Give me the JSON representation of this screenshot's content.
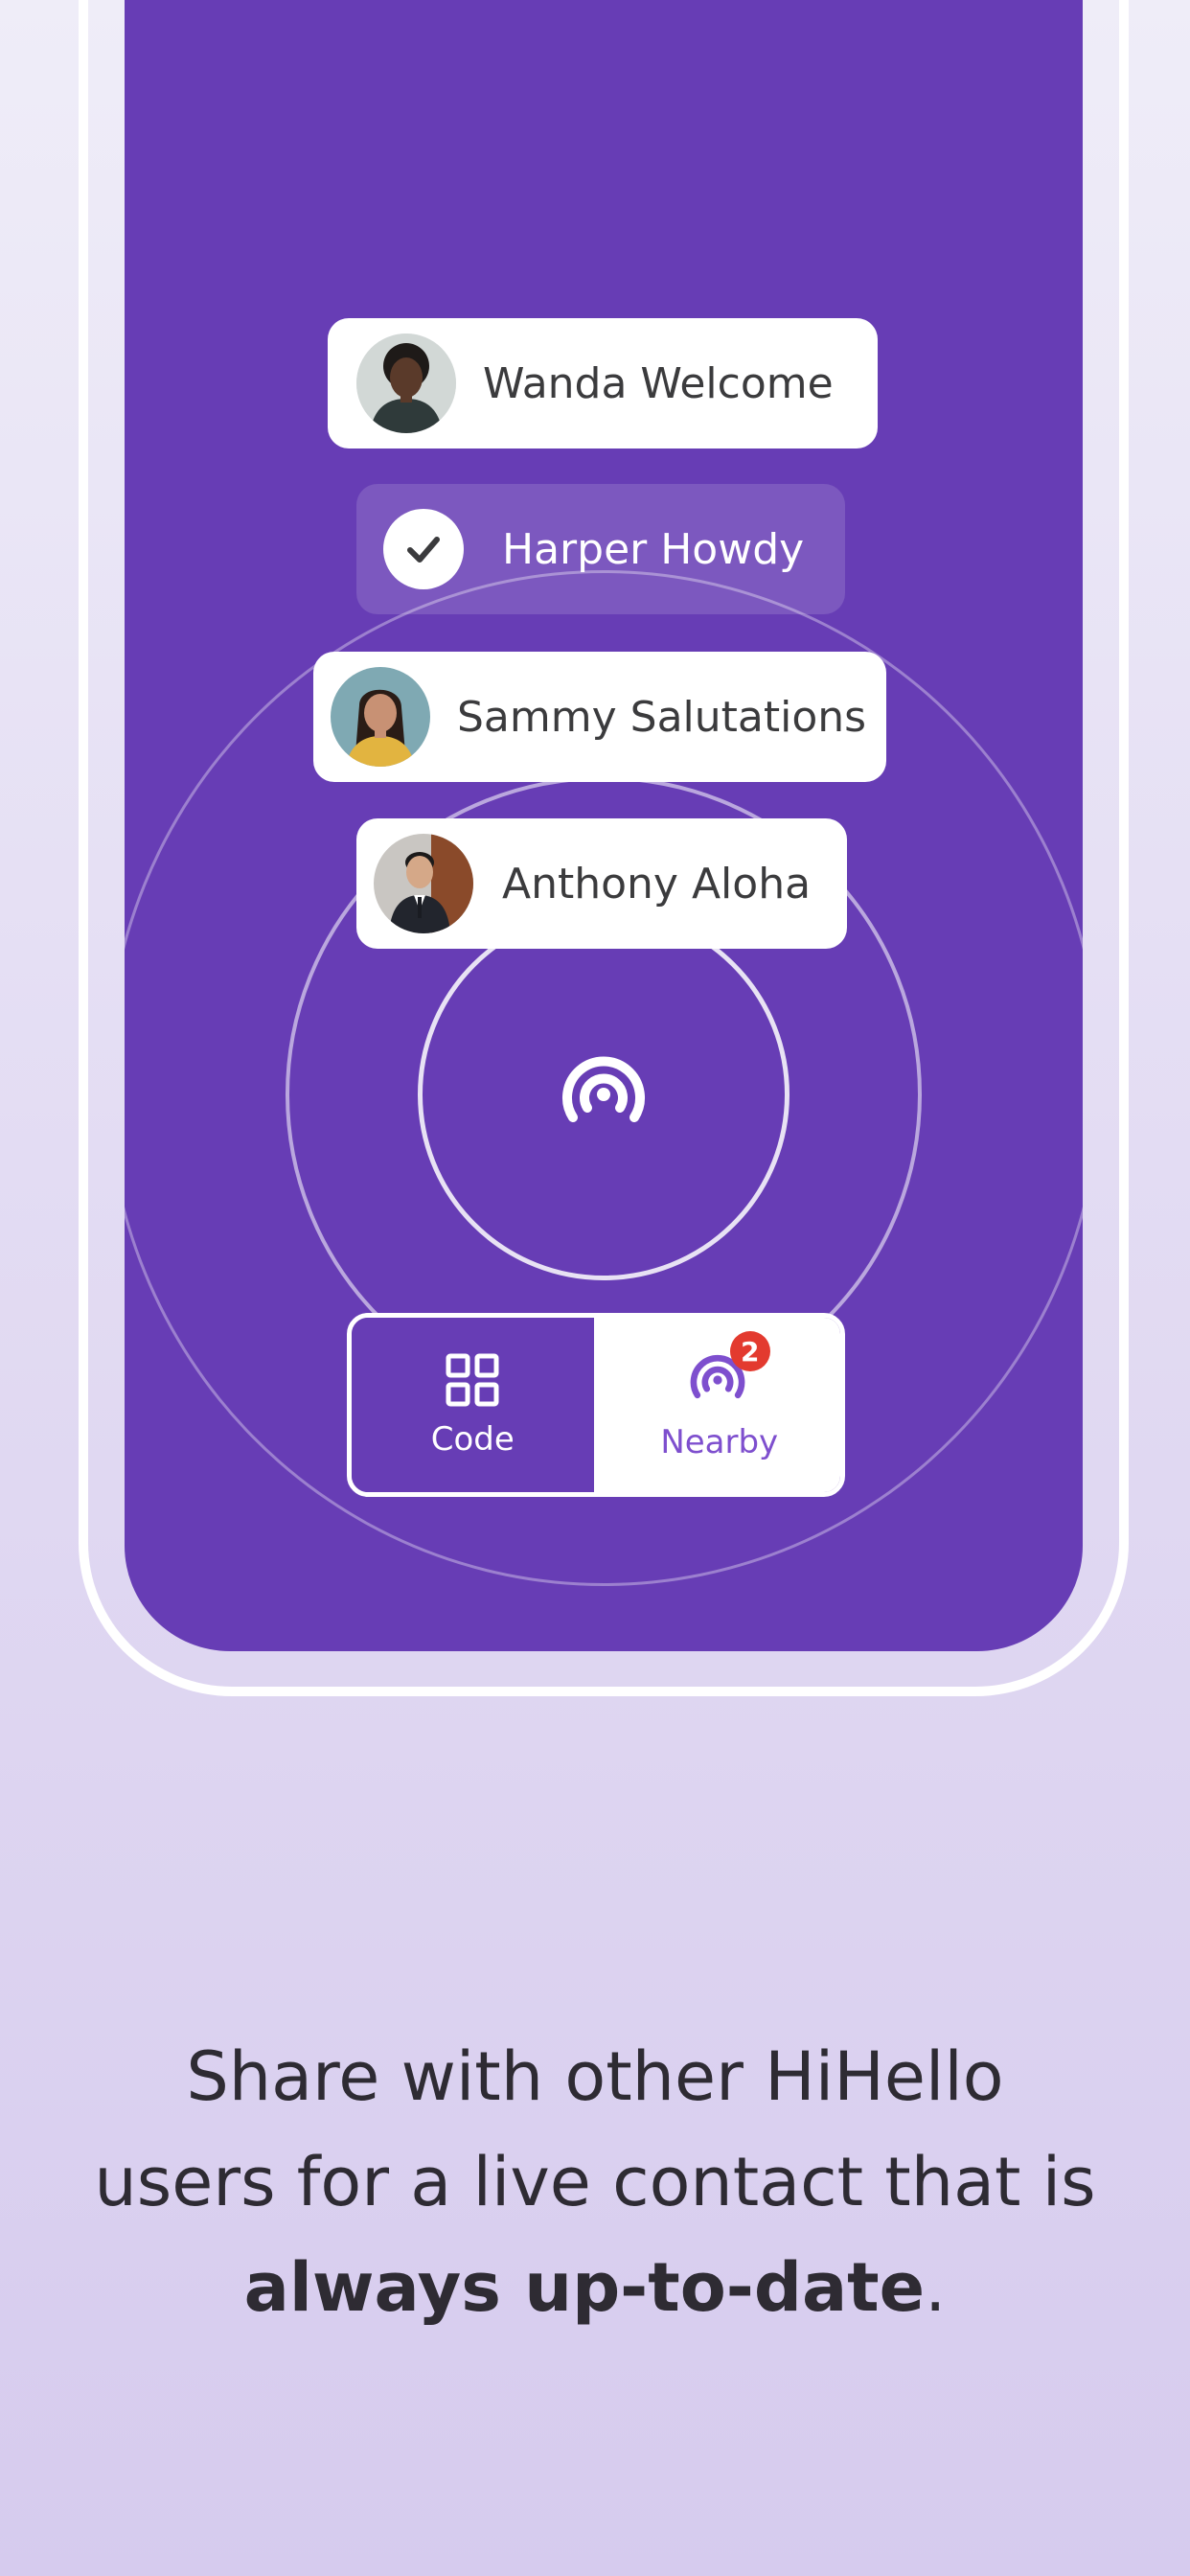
{
  "colors": {
    "screen_background": "#673db5",
    "page_background_top": "#efedf8",
    "page_background_bottom": "#d6cbee",
    "nearby_accent": "#7e4fce",
    "badge": "#e33a2f",
    "caption_text": "#2e2b33"
  },
  "contacts": [
    {
      "name": "Wanda Welcome",
      "icon": "avatar-photo",
      "selected": false
    },
    {
      "name": "Harper Howdy",
      "icon": "check-icon",
      "selected": true
    },
    {
      "name": "Sammy Salutations",
      "icon": "avatar-photo",
      "selected": false
    },
    {
      "name": "Anthony Aloha",
      "icon": "avatar-photo",
      "selected": false
    }
  ],
  "center_icon": "nearby-broadcast-icon",
  "share_toggle": {
    "code": {
      "label": "Code",
      "icon": "qr-code-icon",
      "active": false
    },
    "nearby": {
      "label": "Nearby",
      "icon": "nearby-broadcast-icon",
      "badge": "2",
      "active": true
    }
  },
  "caption": {
    "line1": "Share with other HiHello",
    "line2": "users for a live contact that is",
    "bold": "always up-to-date",
    "end": "."
  }
}
